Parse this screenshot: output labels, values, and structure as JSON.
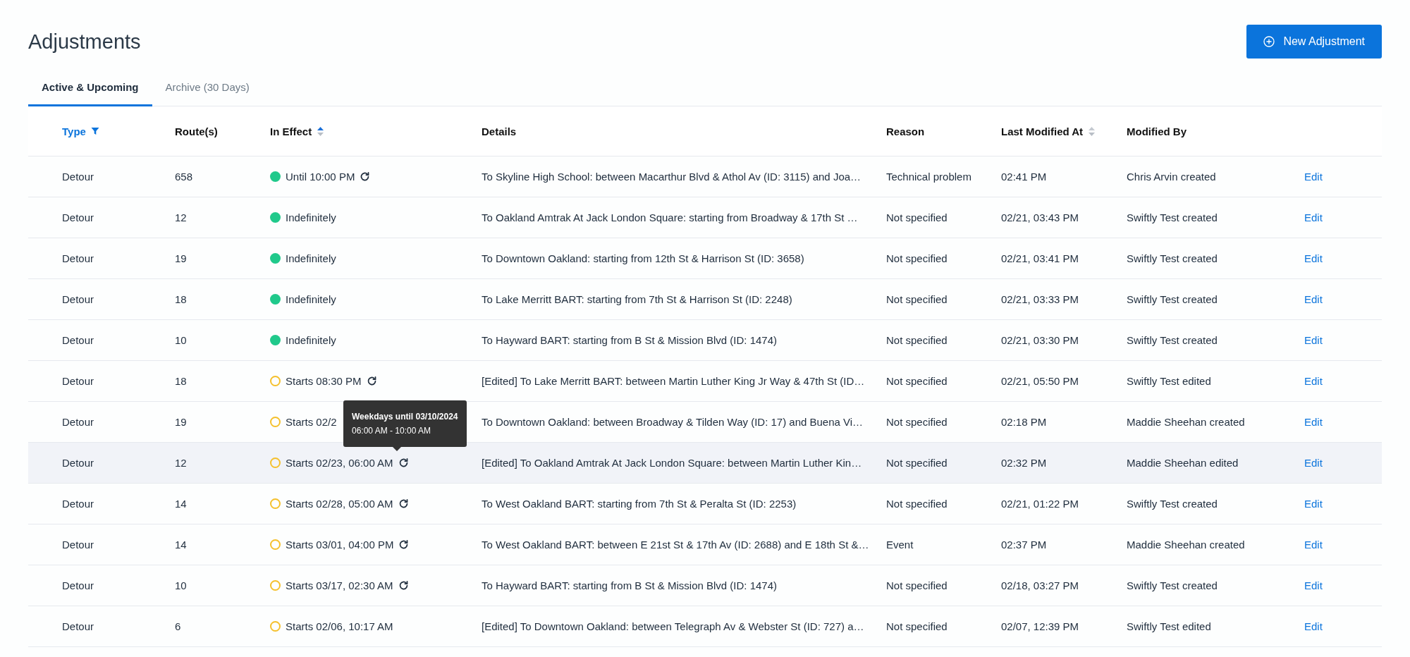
{
  "title": "Adjustments",
  "new_button": "New Adjustment",
  "tabs": [
    {
      "label": "Active & Upcoming",
      "selected": true
    },
    {
      "label": "Archive (30 Days)",
      "selected": false
    }
  ],
  "columns": [
    {
      "label": "Type",
      "filtered": true
    },
    {
      "label": "Route(s)",
      "filtered": false
    },
    {
      "label": "In Effect",
      "filtered": false,
      "sortable": true,
      "sorted_ascending": true
    },
    {
      "label": "Details",
      "filtered": false
    },
    {
      "label": "Reason",
      "filtered": false
    },
    {
      "label": "Last Modified At",
      "filtered": false,
      "sortable": true,
      "sorted_ascending": false
    },
    {
      "label": "Modified By",
      "filtered": false
    }
  ],
  "rows": [
    {
      "type": "Detour",
      "routes": "658",
      "kind": "active",
      "effect": "Until 10:00 PM",
      "recurring": true,
      "details": "To Skyline High School: between Macarthur Blvd & Athol Av (ID: 3115) and Joa…",
      "reason": "Technical problem",
      "modified_at": "02:41 PM",
      "modified_by": "Chris Arvin created",
      "action": "Edit",
      "hovered": false
    },
    {
      "type": "Detour",
      "routes": "12",
      "kind": "active",
      "effect": "Indefinitely",
      "recurring": false,
      "details": "To Oakland Amtrak At Jack London Square: starting from Broadway & 17th St …",
      "reason": "Not specified",
      "modified_at": "02/21, 03:43 PM",
      "modified_by": "Swiftly Test created",
      "action": "Edit",
      "hovered": false
    },
    {
      "type": "Detour",
      "routes": "19",
      "kind": "active",
      "effect": "Indefinitely",
      "recurring": false,
      "details": "To Downtown Oakland: starting from 12th St & Harrison St (ID: 3658)",
      "reason": "Not specified",
      "modified_at": "02/21, 03:41 PM",
      "modified_by": "Swiftly Test created",
      "action": "Edit",
      "hovered": false
    },
    {
      "type": "Detour",
      "routes": "18",
      "kind": "active",
      "effect": "Indefinitely",
      "recurring": false,
      "details": "To Lake Merritt BART: starting from 7th St & Harrison St (ID: 2248)",
      "reason": "Not specified",
      "modified_at": "02/21, 03:33 PM",
      "modified_by": "Swiftly Test created",
      "action": "Edit",
      "hovered": false
    },
    {
      "type": "Detour",
      "routes": "10",
      "kind": "active",
      "effect": "Indefinitely",
      "recurring": false,
      "details": "To Hayward BART: starting from B St & Mission Blvd (ID: 1474)",
      "reason": "Not specified",
      "modified_at": "02/21, 03:30 PM",
      "modified_by": "Swiftly Test created",
      "action": "Edit",
      "hovered": false
    },
    {
      "type": "Detour",
      "routes": "18",
      "kind": "upcoming",
      "effect": "Starts 08:30 PM",
      "recurring": true,
      "details": "[Edited] To Lake Merritt BART: between Martin Luther King Jr Way & 47th St (ID…",
      "reason": "Not specified",
      "modified_at": "02/21, 05:50 PM",
      "modified_by": "Swiftly Test edited",
      "action": "Edit",
      "hovered": false
    },
    {
      "type": "Detour",
      "routes": "19",
      "kind": "upcoming",
      "effect": "Starts 02/2",
      "recurring": false,
      "details": "To Downtown Oakland: between Broadway & Tilden Way (ID: 17) and Buena Vi…",
      "reason": "Not specified",
      "modified_at": "02:18 PM",
      "modified_by": "Maddie Sheehan created",
      "action": "Edit",
      "hovered": false
    },
    {
      "type": "Detour",
      "routes": "12",
      "kind": "upcoming",
      "effect": "Starts 02/23, 06:00 AM",
      "recurring": true,
      "details": "[Edited] To Oakland Amtrak At Jack London Square: between Martin Luther Kin…",
      "reason": "Not specified",
      "modified_at": "02:32 PM",
      "modified_by": "Maddie Sheehan edited",
      "action": "Edit",
      "hovered": true,
      "tooltip": {
        "title": "Weekdays until 03/10/2024",
        "body": "06:00 AM - 10:00 AM"
      }
    },
    {
      "type": "Detour",
      "routes": "14",
      "kind": "upcoming",
      "effect": "Starts 02/28, 05:00 AM",
      "recurring": true,
      "details": "To West Oakland BART: starting from 7th St & Peralta St (ID: 2253)",
      "reason": "Not specified",
      "modified_at": "02/21, 01:22 PM",
      "modified_by": "Swiftly Test created",
      "action": "Edit",
      "hovered": false
    },
    {
      "type": "Detour",
      "routes": "14",
      "kind": "upcoming",
      "effect": "Starts 03/01, 04:00 PM",
      "recurring": true,
      "details": "To West Oakland BART: between E 21st St & 17th Av (ID: 2688) and E 18th St &…",
      "reason": "Event",
      "modified_at": "02:37 PM",
      "modified_by": "Maddie Sheehan created",
      "action": "Edit",
      "hovered": false
    },
    {
      "type": "Detour",
      "routes": "10",
      "kind": "upcoming",
      "effect": "Starts 03/17, 02:30 AM",
      "recurring": true,
      "details": "To Hayward BART: starting from B St & Mission Blvd (ID: 1474)",
      "reason": "Not specified",
      "modified_at": "02/18, 03:27 PM",
      "modified_by": "Swiftly Test created",
      "action": "Edit",
      "hovered": false
    },
    {
      "type": "Detour",
      "routes": "6",
      "kind": "upcoming",
      "effect": "Starts 02/06, 10:17 AM",
      "recurring": false,
      "details": "[Edited] To Downtown Oakland: between Telegraph Av & Webster St (ID: 727) a…",
      "reason": "Not specified",
      "modified_at": "02/07, 12:39 PM",
      "modified_by": "Swiftly Test edited",
      "action": "Edit",
      "hovered": false
    }
  ]
}
